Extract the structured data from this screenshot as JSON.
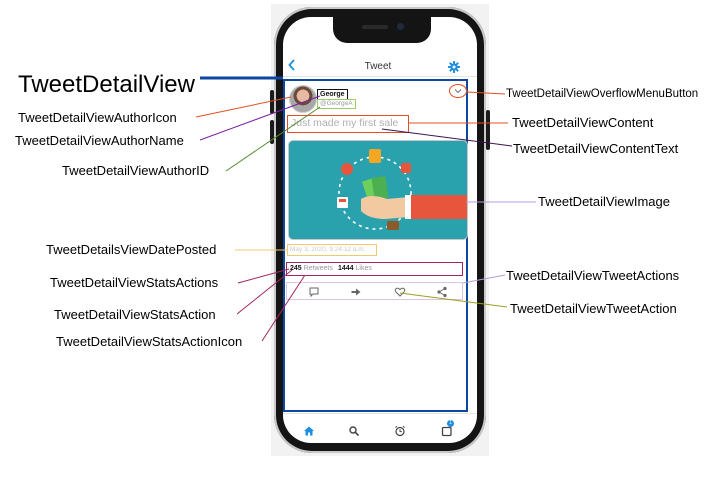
{
  "screen": {
    "nav": {
      "back_icon": "chevron-left-icon",
      "title": "Tweet",
      "settings_icon": "gear-icon"
    },
    "tweet": {
      "author_name": "George",
      "author_id": "@GeorgeA",
      "content_text": "Just made my first sale",
      "date_posted": "May 3, 2020, 9:24:12 a.m.",
      "stats": [
        {
          "count": "245",
          "label": "Retweets"
        },
        {
          "count": "1444",
          "label": "Likes"
        }
      ],
      "actions": [
        "comment-icon",
        "retweet-icon",
        "heart-icon",
        "share-icon"
      ],
      "overflow_icon": "chevron-down-icon"
    },
    "tabbar": {
      "items": [
        "home-icon",
        "search-icon",
        "alarm-icon",
        "messages-icon"
      ],
      "badge": "1",
      "active_color": "#1d8fe0"
    }
  },
  "annotations": {
    "tweet_detail_view": "TweetDetailView",
    "author_icon": "TweetDetailViewAuthorIcon",
    "author_name": "TweetDetailViewAuthorName",
    "author_id": "TweetDetailViewAuthorID",
    "date_posted": "TweetDetailsViewDatePosted",
    "stats_actions": "TweetDetailViewStatsActions",
    "stats_action": "TweetDetailViewStatsAction",
    "stats_action_icon": "TweetDetailViewStatsActionIcon",
    "overflow_menu_button": "TweetDetailViewOverflowMenuButton",
    "content": "TweetDetailViewContent",
    "content_text": "TweetDetailViewContentText",
    "image": "TweetDetailViewImage",
    "tweet_actions": "TweetDetailViewTweetActions",
    "tweet_action": "TweetDetailViewTweetAction"
  },
  "colors": {
    "frame_blue": "#0d47a1",
    "leader_orange": "#e05020",
    "leader_purple": "#7b1fa2",
    "leader_green": "#558b2f",
    "leader_gold": "#f2c86b",
    "leader_maroon": "#a3245e",
    "leader_lavender": "#b39ddb",
    "leader_olive": "#9e9d24"
  }
}
